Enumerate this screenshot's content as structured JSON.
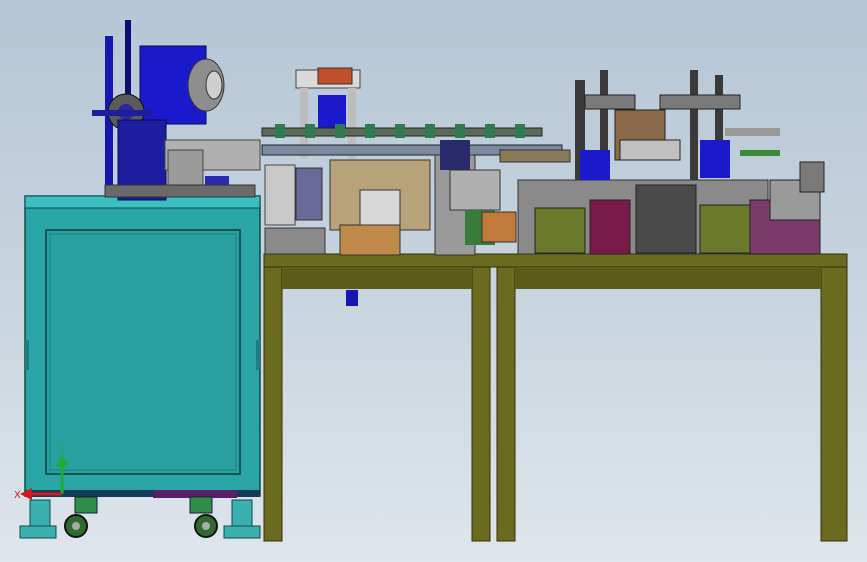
{
  "viewport": {
    "background_top": "#b6c6d6",
    "background_bottom": "#dfe6ec"
  },
  "triad": {
    "x_label": "X",
    "y_label": "Y",
    "x_color": "#d11a1a",
    "y_color": "#1fae2a"
  },
  "colors": {
    "cabinet": "#2aa6a6",
    "cabinet_dark": "#1d7f80",
    "table": "#6b6b20",
    "table_dark": "#4a4a12",
    "spool_blue": "#1616b0",
    "mechanism_gray": "#8e8e8e"
  }
}
